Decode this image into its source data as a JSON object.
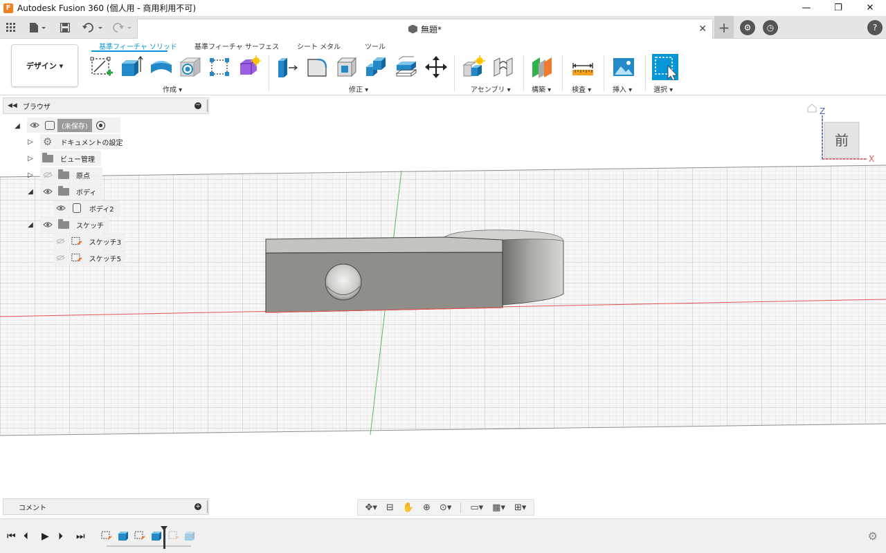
{
  "window": {
    "title": "Autodesk Fusion 360 (個人用 - 商用利用不可)",
    "controls": [
      "minimize-icon",
      "restore-icon",
      "close-icon"
    ]
  },
  "tabbar": {
    "document_title": "無題*",
    "close_glyph": "✕",
    "quick_access": [
      "grid-icon",
      "file-icon",
      "save-icon",
      "undo-icon",
      "redo-icon"
    ],
    "right_buttons": [
      "new-tab-icon",
      "extensions-icon",
      "history-icon",
      "help-icon"
    ]
  },
  "ribbon": {
    "workspace": "デザイン ▾",
    "tabs": [
      {
        "label": "基準フィーチャ ソリッド",
        "active": true
      },
      {
        "label": "基準フィーチャ サーフェス",
        "active": false
      },
      {
        "label": "シート メタル",
        "active": false
      },
      {
        "label": "ツール",
        "active": false
      }
    ],
    "groups": {
      "create": "作成 ▾",
      "modify": "修正 ▾",
      "assemble": "アセンブリ ▾",
      "construct": "構築 ▾",
      "inspect": "検査 ▾",
      "insert": "挿入 ▾",
      "select": "選択 ▾"
    },
    "accent_color": "#0696d7"
  },
  "browser": {
    "title": "ブラウザ",
    "root": "(未保存)",
    "items": [
      {
        "label": "ドキュメントの設定"
      },
      {
        "label": "ビュー管理"
      },
      {
        "label": "原点"
      },
      {
        "label": "ボディ"
      },
      {
        "label": "ボディ2"
      },
      {
        "label": "スケッチ"
      },
      {
        "label": "スケッチ3"
      },
      {
        "label": "スケッチ5"
      }
    ]
  },
  "viewcube": {
    "face": "前",
    "axis_z": "Z",
    "axis_x": "X"
  },
  "comments": {
    "title": "コメント"
  },
  "navbar": {
    "tools": [
      "orbit-icon",
      "look-at-icon",
      "pan-icon",
      "zoom-icon",
      "fit-icon",
      "display-settings-icon",
      "grid-settings-icon",
      "viewports-icon"
    ]
  },
  "timeline": {
    "controls": [
      "first-icon",
      "previous-icon",
      "play-icon",
      "next-icon",
      "last-icon"
    ],
    "items": [
      "sketch",
      "extrude",
      "sketch",
      "extrude",
      "sketch",
      "extrude"
    ]
  }
}
